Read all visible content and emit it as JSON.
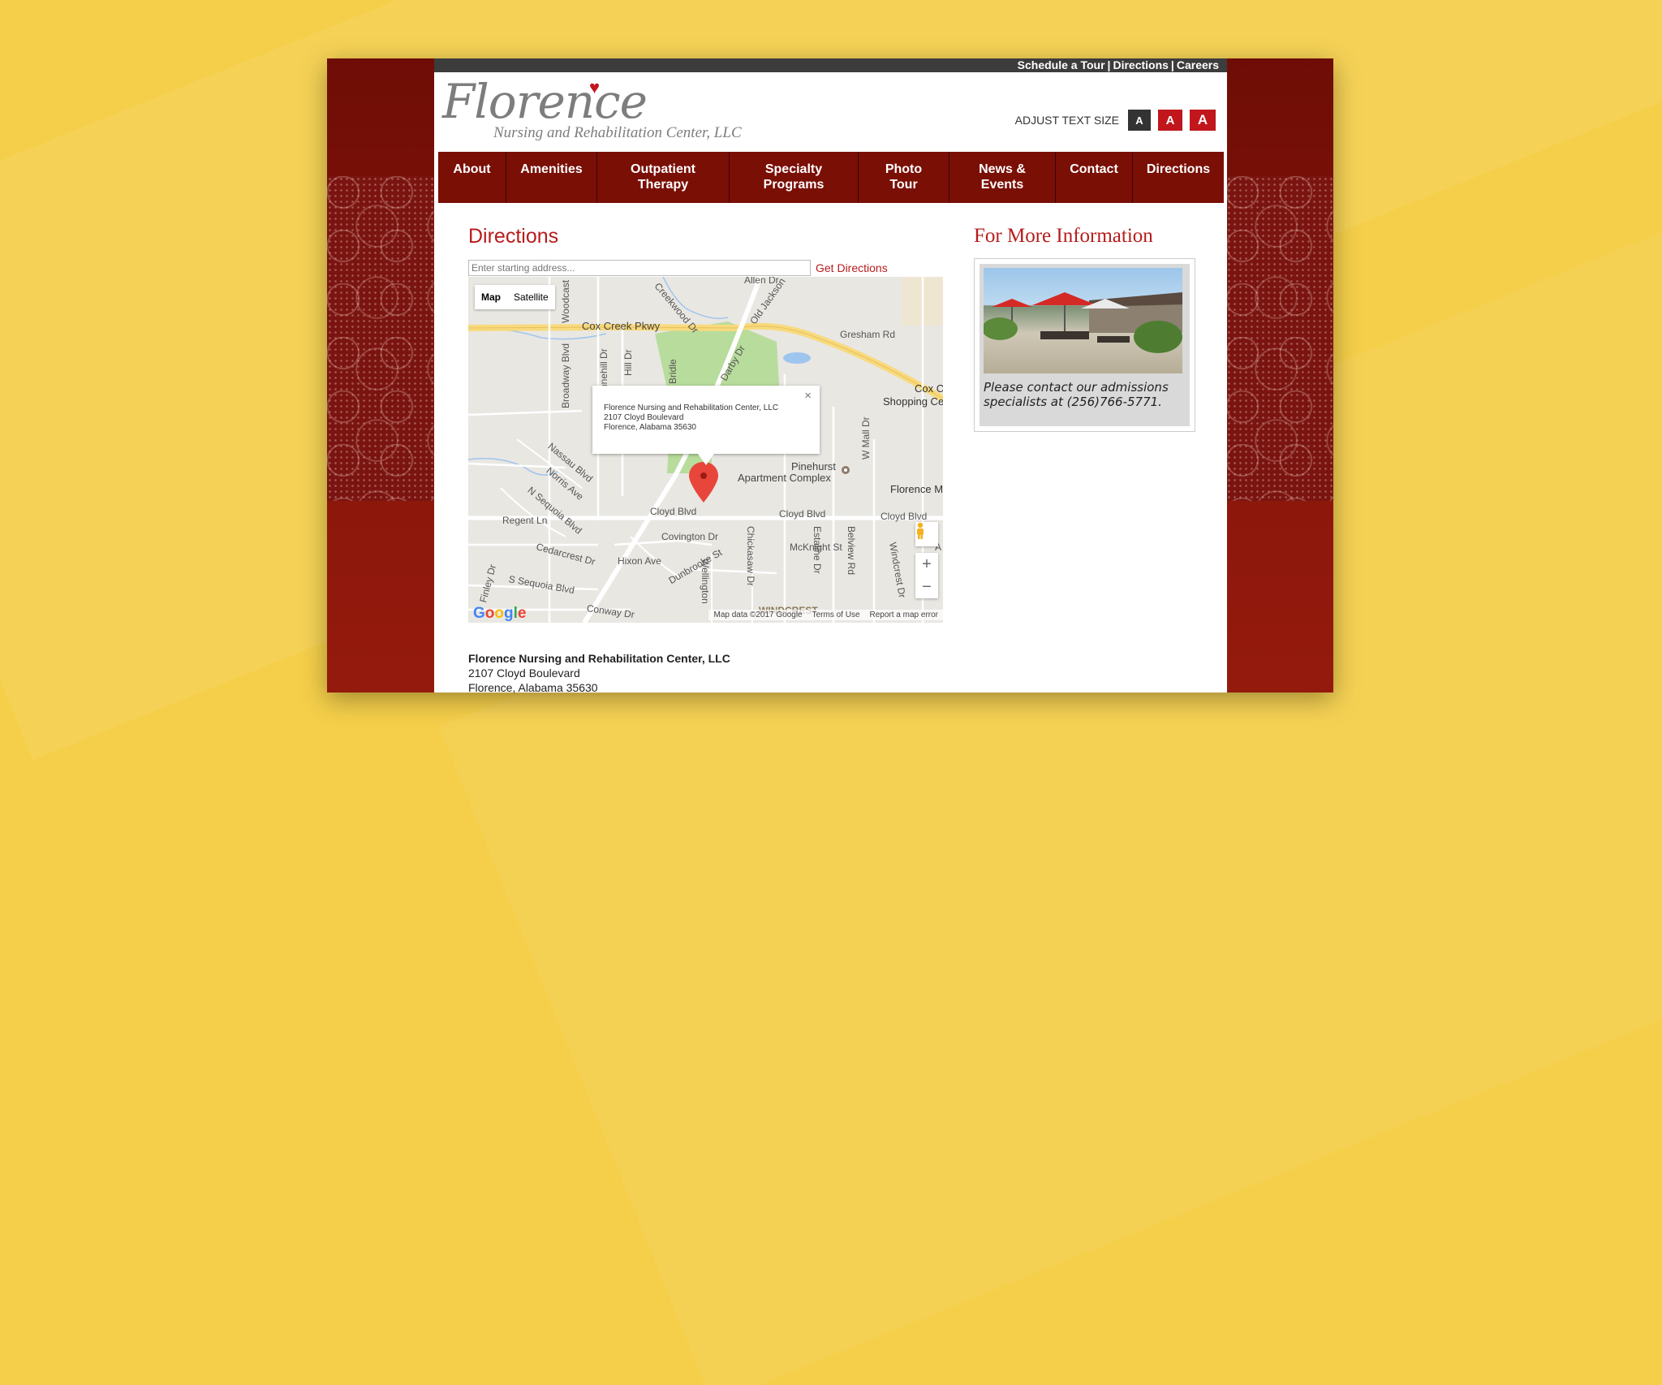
{
  "topbar": {
    "links": [
      "Schedule a Tour",
      "Directions",
      "Careers"
    ],
    "separator": "|"
  },
  "logo": {
    "name": "Florence",
    "subtitle": "Nursing and Rehabilitation Center, LLC",
    "heart": "♥"
  },
  "text_size": {
    "label": "ADJUST TEXT SIZE",
    "buttons": [
      "A",
      "A",
      "A"
    ]
  },
  "nav": [
    {
      "label": "About"
    },
    {
      "label": "Amenities"
    },
    {
      "label": "Outpatient Therapy"
    },
    {
      "label": "Specialty Programs"
    },
    {
      "label": "Photo Tour"
    },
    {
      "label": "News & Events"
    },
    {
      "label": "Contact"
    },
    {
      "label": "Directions"
    }
  ],
  "directions": {
    "heading": "Directions",
    "input_placeholder": "Enter starting address...",
    "button": "Get Directions"
  },
  "map": {
    "map_types": [
      "Map",
      "Satellite"
    ],
    "info_window": {
      "line1": "Florence Nursing and Rehabilitation Center, LLC",
      "line2": "2107 Cloyd Boulevard",
      "line3": "Florence, Alabama 35630",
      "close": "×"
    },
    "street_labels": [
      "Cox Creek Pkwy",
      "Gresham Rd",
      "Creekwood Dr",
      "Old Jackson",
      "Allen Dr",
      "Woodcast",
      "Broadway Blvd",
      "Annehill Dr",
      "Hill Dr",
      "Bridle",
      "Darby Dr",
      "Cox C",
      "Shopping Ce",
      "Nassau Blvd",
      "Norris Ave",
      "N Sequoia Blvd",
      "Regent Ln",
      "Cedarcrest Dr",
      "S Sequoia Blvd",
      "Finley Dr",
      "Conway Dr",
      "Cloyd Blvd",
      "Cloyd Blvd",
      "Cloyd Blvd",
      "Covington Dr",
      "Hixon Ave",
      "Dunbrooke St",
      "Wellington",
      "Chickasaw Dr",
      "McKnight St",
      "Estaline Dr",
      "Belview Rd",
      "Windcrest Dr",
      "W Mall Dr",
      "Pinehurst",
      "Apartment Complex",
      "Florence M",
      "WINDCREST",
      "A"
    ],
    "zoom_in": "+",
    "zoom_out": "−",
    "google": [
      "G",
      "o",
      "o",
      "g",
      "l",
      "e"
    ],
    "footer": [
      "Map data ©2017 Google",
      "Terms of Use",
      "Report a map error"
    ]
  },
  "address": {
    "name": "Florence Nursing and Rehabilitation Center, LLC",
    "street": "2107 Cloyd Boulevard",
    "city": "Florence, Alabama 35630"
  },
  "more_info": {
    "heading": "For More Information",
    "text": "Please contact our admissions specialists at (256)766-5771."
  },
  "colors": {
    "background": "#f5cf4a",
    "frame": "#7a1410",
    "nav": "#7a0f06",
    "accent": "#b71c1c"
  }
}
